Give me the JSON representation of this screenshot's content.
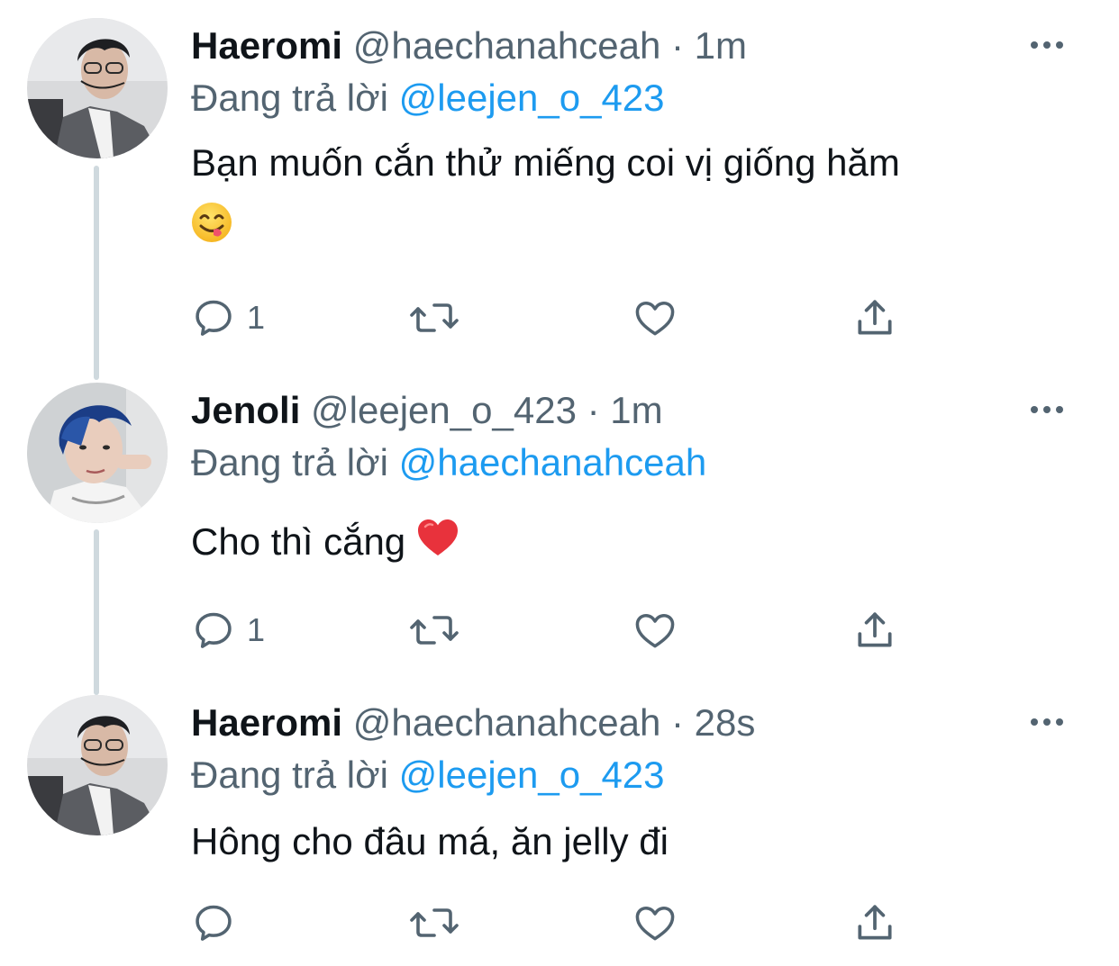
{
  "tweets": [
    {
      "name": "Haeromi",
      "handle": "@haechanahceah",
      "dot": "·",
      "time": "1m",
      "reply_prefix": "Đang trả lời",
      "reply_to": "@leejen_o_423",
      "text_line1": "Bạn muốn cắn thử miếng coi vị giống hăm",
      "reply_count": "1"
    },
    {
      "name": "Jenoli",
      "handle": "@leejen_o_423",
      "dot": "·",
      "time": "1m",
      "reply_prefix": "Đang trả lời",
      "reply_to": "@haechanahceah",
      "text": "Cho thì cắng",
      "reply_count": "1"
    },
    {
      "name": "Haeromi",
      "handle": "@haechanahceah",
      "dot": "·",
      "time": "28s",
      "reply_prefix": "Đang trả lời",
      "reply_to": "@leejen_o_423",
      "text": "Hông cho đâu má, ăn jelly đi",
      "reply_count": ""
    }
  ],
  "colors": {
    "text": "#0f1419",
    "secondary": "#536471",
    "link": "#1d9bf0",
    "thread_line": "#cfd9de"
  },
  "icons": [
    "reply-icon",
    "retweet-icon",
    "like-icon",
    "share-icon",
    "more-icon",
    "yum-emoji",
    "heart-emoji"
  ]
}
